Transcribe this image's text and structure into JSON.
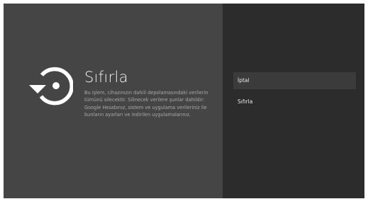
{
  "dialog": {
    "icon": "reset-icon",
    "title": "Sıfırla",
    "description": "Bu işlem, cihazınızın dahili depolamasındaki verilerin tümünü silecektir. Silinecek verilere şunlar dahildir: Google Hesabınız, sistem ve uygulama verileriniz ile bunların ayarları ve indirilen uygulamalarınız."
  },
  "menu": {
    "items": [
      {
        "label": "İptal",
        "selected": true
      },
      {
        "label": "Sıfırla",
        "selected": false
      }
    ]
  },
  "colors": {
    "left_panel": "#454545",
    "right_panel": "#2c2c2c",
    "selected_item": "#3b3b3b",
    "title_text": "#f2f2f2",
    "body_text": "#a9a9a9"
  }
}
